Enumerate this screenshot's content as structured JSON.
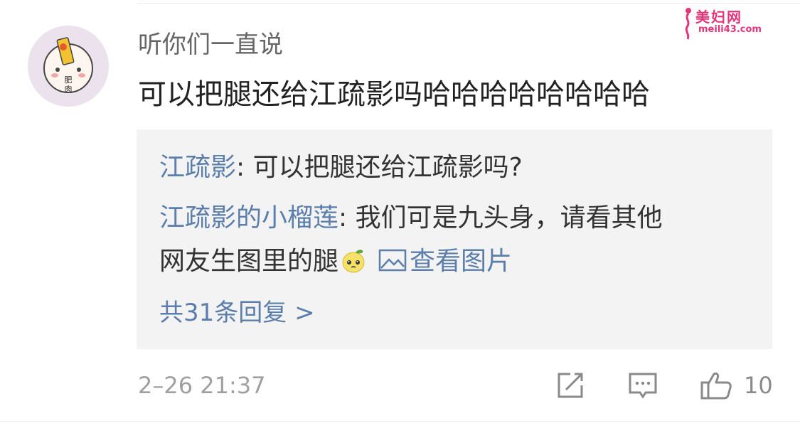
{
  "watermark": {
    "title": "美妇网",
    "sub": "meili43.com"
  },
  "avatar": {
    "label_top": "肥",
    "label_bottom": "肉"
  },
  "comment": {
    "username": "听你们一直说",
    "text": "可以把腿还给江疏影吗哈哈哈哈哈哈哈哈",
    "timestamp": "2–26 21:37",
    "like_count": "10"
  },
  "replies": [
    {
      "author": "江疏影",
      "separator": ": ",
      "text": "可以把腿还给江疏影吗?"
    },
    {
      "author": "江疏影的小榴莲",
      "separator": ": ",
      "text": "我们可是九头身，请看其他",
      "text_cont": "网友生图里的腿",
      "emoji_icon": "pear-face-emoji",
      "view_pic_label": "查看图片",
      "view_pic_icon": "image-icon"
    }
  ],
  "reply_count_label": "共31条回复 >",
  "icons": {
    "share": "share-icon",
    "comment": "comment-icon",
    "like": "thumbs-up-icon"
  },
  "colors": {
    "link": "#5b7faa",
    "reply_bg": "#f3f3f3",
    "watermark": "#e3357a"
  }
}
